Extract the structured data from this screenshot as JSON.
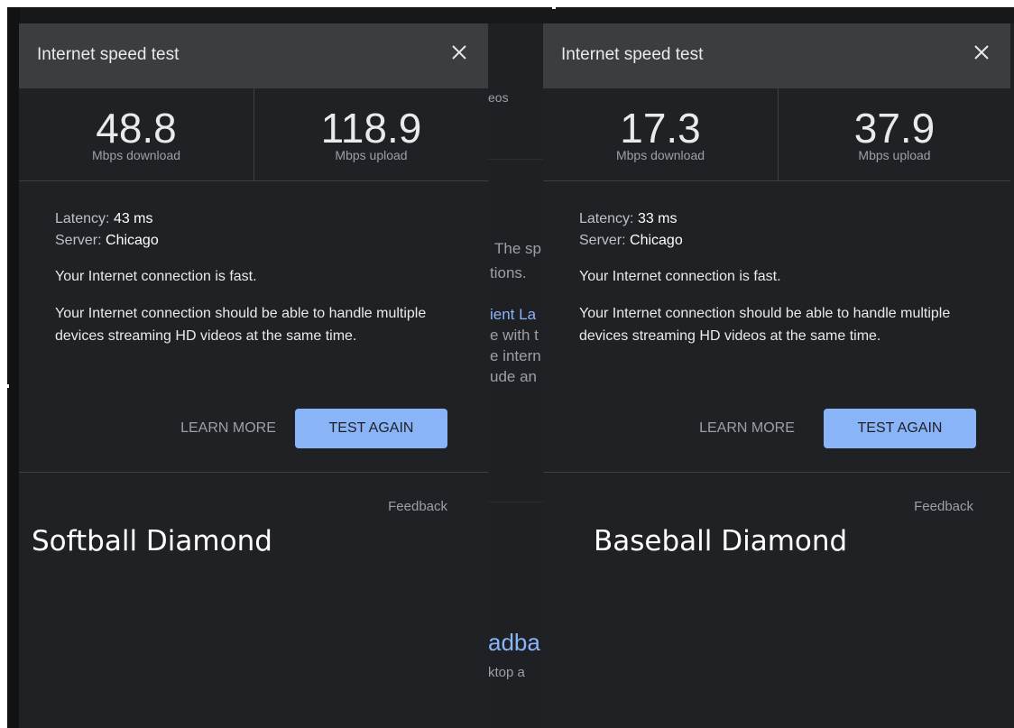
{
  "background": {
    "frag_eos": "eos",
    "frag_the_sp": "The sp",
    "frag_tions": "tions.",
    "frag_ient_la": "ient La",
    "frag_e_with_t": "e with t",
    "frag_e_intern": "e intern",
    "frag_ude_an": "ude an",
    "frag_adba": "adba",
    "frag_ktop_a": "ktop a"
  },
  "cards": [
    {
      "title": "Internet speed test",
      "download_value": "48.8",
      "download_unit": "Mbps download",
      "upload_value": "118.9",
      "upload_unit": "Mbps upload",
      "latency_label": "Latency: ",
      "latency_value": "43 ms",
      "server_label": "Server: ",
      "server_value": "Chicago",
      "status": "Your Internet connection is fast.",
      "description": "Your Internet connection should be able to handle multiple devices streaming HD videos at the same time.",
      "learn_more_label": "LEARN MORE",
      "test_again_label": "TEST AGAIN",
      "feedback_label": "Feedback",
      "caption": "Softball Diamond"
    },
    {
      "title": "Internet speed test",
      "download_value": "17.3",
      "download_unit": "Mbps download",
      "upload_value": "37.9",
      "upload_unit": "Mbps upload",
      "latency_label": "Latency: ",
      "latency_value": "33 ms",
      "server_label": "Server: ",
      "server_value": "Chicago",
      "status": "Your Internet connection is fast.",
      "description": "Your Internet connection should be able to handle multiple devices streaming HD videos at the same time.",
      "learn_more_label": "LEARN MORE",
      "test_again_label": "TEST AGAIN",
      "feedback_label": "Feedback",
      "caption": "Baseball Diamond"
    }
  ],
  "colors": {
    "accent": "#8ab4f8",
    "panel": "#202124",
    "header": "#3c3d40"
  },
  "icons": {
    "close": "close-icon"
  }
}
